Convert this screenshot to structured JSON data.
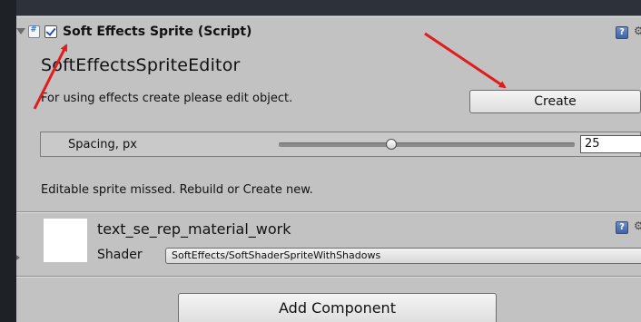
{
  "component": {
    "title": "Soft Effects Sprite (Script)",
    "enabled": true,
    "editor_title": "SoftEffectsSpriteEditor",
    "info_text": "For using effects create please edit object.",
    "create_button": "Create",
    "spacing": {
      "label": "Spacing, px",
      "value": "25",
      "slider_fraction": 0.38
    },
    "warning_text": "Editable sprite missed. Rebuild or Create new."
  },
  "material": {
    "name": "text_se_rep_material_work",
    "shader_label": "Shader",
    "shader_value": "SoftEffects/SoftShaderSpriteWithShadows"
  },
  "add_component_button": "Add Component",
  "colors": {
    "arrow": "#e21b1b",
    "panel": "#c2c2c2",
    "background": "#1e2227"
  },
  "icons": [
    "foldout-arrow-icon",
    "script-icon",
    "checkbox-icon",
    "help-icon",
    "settings-gear-icon"
  ]
}
